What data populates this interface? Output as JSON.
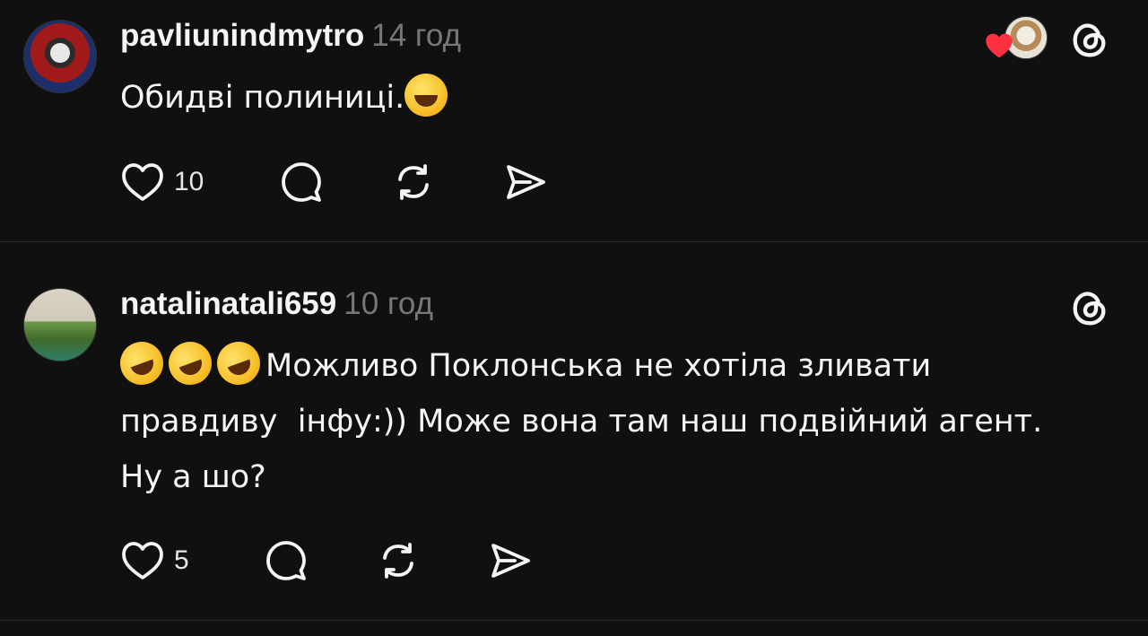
{
  "posts": [
    {
      "username": "pavliunindmytro",
      "time": "14 год",
      "text": "Обидві полиниці.",
      "emoji": [
        "grinning-face"
      ],
      "likes": "10",
      "liked_by_author": true,
      "icons": {
        "like": "heart-icon",
        "comment": "comment-icon",
        "repost": "repost-icon",
        "share": "share-icon",
        "app": "threads-icon"
      }
    },
    {
      "username": "natalinatali659",
      "time": "10 год",
      "emoji": [
        "rolling-on-floor-laughing",
        "rolling-on-floor-laughing",
        "rolling-on-floor-laughing"
      ],
      "text": "Можливо Поклонська не хотіла зливати правдиву  інфу:)) Може вона там наш подвійний агент. Ну а шо?",
      "likes": "5",
      "icons": {
        "like": "heart-icon",
        "comment": "comment-icon",
        "repost": "repost-icon",
        "share": "share-icon",
        "app": "threads-icon"
      }
    }
  ],
  "colors": {
    "background": "#101010",
    "text": "#f3f5f7",
    "muted": "#777777",
    "divider": "#2a2a2a",
    "heart_red": "#ff3040"
  }
}
